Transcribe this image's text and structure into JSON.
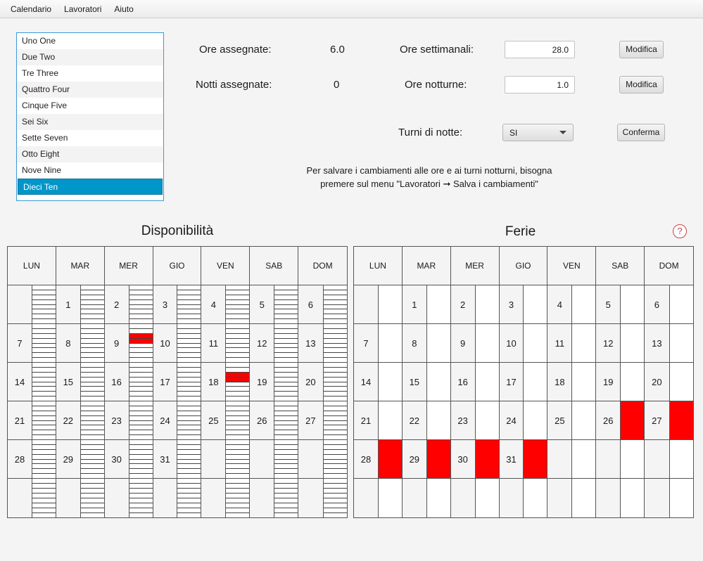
{
  "menu": [
    "Calendario",
    "Lavoratori",
    "Aiuto"
  ],
  "workers": [
    "Uno One",
    "Due Two",
    "Tre Three",
    "Quattro Four",
    "Cinque Five",
    "Sei Six",
    "Sette Seven",
    "Otto Eight",
    "Nove Nine",
    "Dieci Ten"
  ],
  "selected_worker": "Dieci Ten",
  "stats": {
    "ore_assegnate_label": "Ore assegnate:",
    "ore_assegnate_value": "6.0",
    "notti_assegnate_label": "Notti assegnate:",
    "notti_assegnate_value": "0"
  },
  "settings": {
    "ore_settimanali_label": "Ore settimanali:",
    "ore_settimanali_value": "28.0",
    "ore_notturne_label": "Ore notturne:",
    "ore_notturne_value": "1.0",
    "modifica_label": "Modifica",
    "turni_label": "Turni di notte:",
    "turni_value": "SI",
    "conferma_label": "Conferma"
  },
  "note": {
    "line1": "Per salvare i cambiamenti alle ore e ai turni notturni, bisogna",
    "line2": "premere sul menu \"Lavoratori ➞  Salva i cambiamenti\""
  },
  "help": "?",
  "days": [
    "LUN",
    "MAR",
    "MER",
    "GIO",
    "VEN",
    "SAB",
    "DOM"
  ],
  "month_start_offset": 1,
  "days_in_month": 31,
  "disponibilita": {
    "title": "Disponibilità",
    "unavailable_slots": [
      {
        "day": 9,
        "hours": [
          2,
          3
        ]
      },
      {
        "day": 18,
        "hours": [
          2,
          3
        ]
      }
    ]
  },
  "ferie": {
    "title": "Ferie",
    "days_off": [
      26,
      27,
      28,
      29,
      30,
      31
    ]
  },
  "colors": {
    "accent": "#0096c9",
    "marked": "#ff0000"
  }
}
